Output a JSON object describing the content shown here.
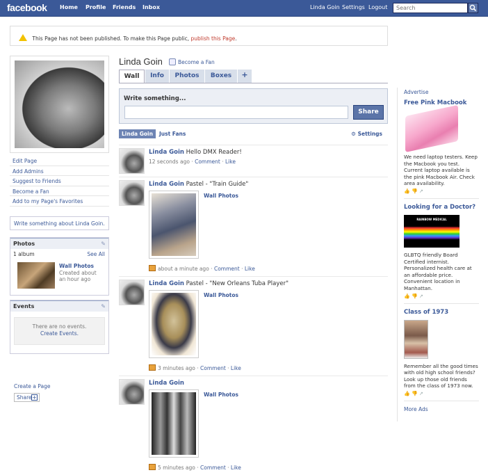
{
  "topbar": {
    "logo": "facebook",
    "nav": [
      "Home",
      "Profile",
      "Friends",
      "Inbox"
    ],
    "user": "Linda Goin",
    "settings": "Settings",
    "logout": "Logout",
    "search_placeholder": "Search"
  },
  "notice": {
    "text": "This Page has not been published. To make this Page public, ",
    "link": "publish this Page",
    "end": "."
  },
  "page": {
    "name": "Linda Goin",
    "become_fan": "Become a Fan",
    "tabs": [
      "Wall",
      "Info",
      "Photos",
      "Boxes",
      "+"
    ]
  },
  "left": {
    "links": [
      "Edit Page",
      "Add Admins",
      "Suggest to Friends",
      "Become a Fan",
      "Add to my Page's Favorites"
    ],
    "write_about": "Write something about Linda Goin.",
    "photos": {
      "title": "Photos",
      "album_count": "1 album",
      "see_all": "See All",
      "album_name": "Wall Photos",
      "album_meta": "Created about an hour ago"
    },
    "events": {
      "title": "Events",
      "empty": "There are no events.",
      "create": "Create Events."
    },
    "create_page": "Create a Page",
    "share": "Share"
  },
  "publisher": {
    "label": "Write something...",
    "button": "Share"
  },
  "filter": {
    "active": "Linda Goin",
    "just_fans": "Just Fans",
    "settings": "Settings"
  },
  "posts": [
    {
      "name": "Linda Goin",
      "text": "Hello DMX Reader!",
      "time": "12 seconds ago",
      "comment": "Comment",
      "like": "Like"
    },
    {
      "name": "Linda Goin",
      "text": "Pastel - \"Train Guide\"",
      "album": "Wall Photos",
      "time": "about a minute ago",
      "comment": "Comment",
      "like": "Like"
    },
    {
      "name": "Linda Goin",
      "text": "Pastel - \"New Orleans Tuba Player\"",
      "album": "Wall Photos",
      "time": "3 minutes ago",
      "comment": "Comment",
      "like": "Like"
    },
    {
      "name": "Linda Goin",
      "text": "",
      "album": "Wall Photos",
      "time": "5 minutes ago",
      "comment": "Comment",
      "like": "Like"
    }
  ],
  "ads": {
    "header": "Advertise",
    "items": [
      {
        "title": "Free Pink Macbook",
        "text": "We need laptop testers. Keep the Macbook you test. Current laptop available is the pink Macbook Air. Check area availability."
      },
      {
        "title": "Looking for a Doctor?",
        "banner": "RAINBOW MEDICAL",
        "text": "GLBTQ friendly Board Certified internist. Personalized health care at an affordable price. Convenient location in Manhattan."
      },
      {
        "title": "Class of 1973",
        "text": "Remember all the good times with old high school friends? Look up those old friends from the class of 1973 now."
      }
    ],
    "more": "More Ads"
  }
}
